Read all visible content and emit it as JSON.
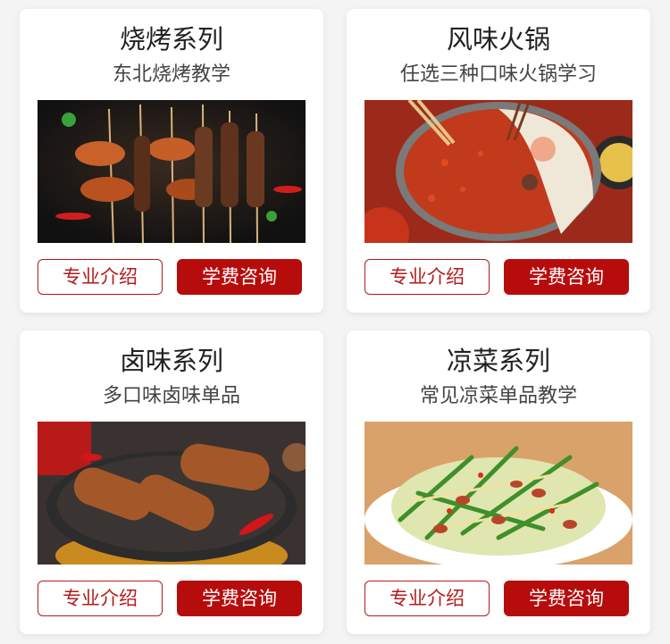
{
  "cards": [
    {
      "title": "烧烤系列",
      "subtitle": "东北烧烤教学",
      "image_subject": "grilled-skewers-photo",
      "intro_label": "专业介绍",
      "consult_label": "学费咨询"
    },
    {
      "title": "风味火锅",
      "subtitle": "任选三种口味火锅学习",
      "image_subject": "hotpot-photo",
      "intro_label": "专业介绍",
      "consult_label": "学费咨询"
    },
    {
      "title": "卤味系列",
      "subtitle": "多口味卤味单品",
      "image_subject": "braised-duck-necks-photo",
      "intro_label": "专业介绍",
      "consult_label": "学费咨询"
    },
    {
      "title": "凉菜系列",
      "subtitle": "常见凉菜单品教学",
      "image_subject": "cold-cucumber-salad-photo",
      "intro_label": "专业介绍",
      "consult_label": "学费咨询"
    }
  ],
  "colors": {
    "accent": "#b70c0c",
    "outline": "#b31b1b",
    "card_bg": "#ffffff",
    "page_bg": "#f4f4f4"
  }
}
